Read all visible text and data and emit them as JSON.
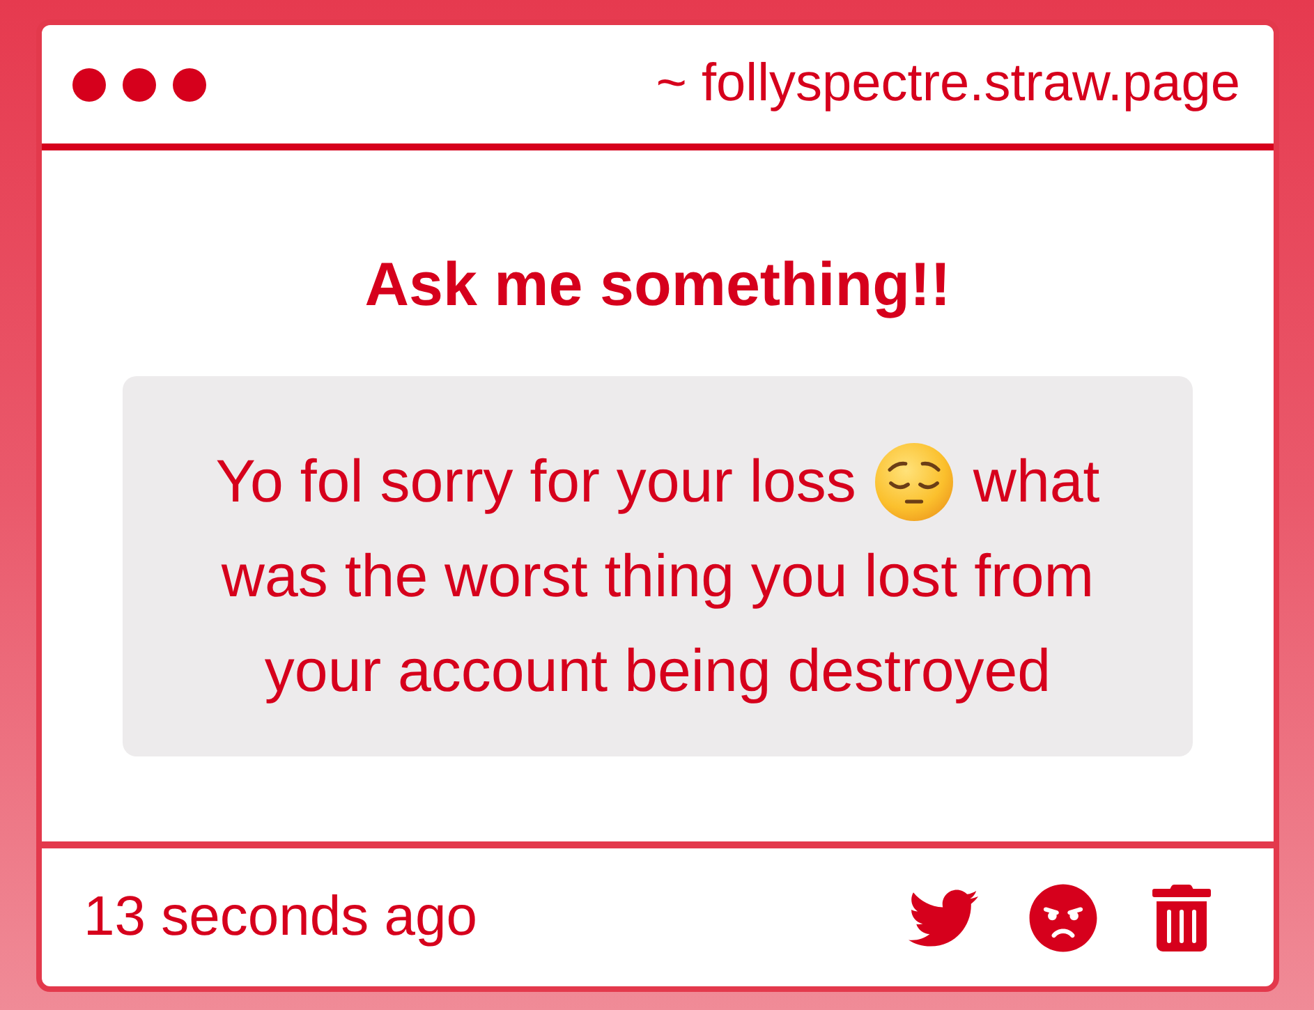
{
  "window": {
    "address": "~ follyspectre.straw.page"
  },
  "prompt": {
    "title": "Ask me something!!"
  },
  "question": {
    "lines": [
      [
        {
          "kind": "text",
          "text": "Yo fol sorry for your loss"
        },
        {
          "kind": "emoji"
        },
        {
          "kind": "text",
          "text": "what"
        }
      ],
      [
        {
          "kind": "text",
          "text": "was the worst thing you lost from"
        }
      ],
      [
        {
          "kind": "text",
          "text": "your account being destroyed"
        }
      ]
    ]
  },
  "footer": {
    "time": "13 seconds ago"
  }
}
